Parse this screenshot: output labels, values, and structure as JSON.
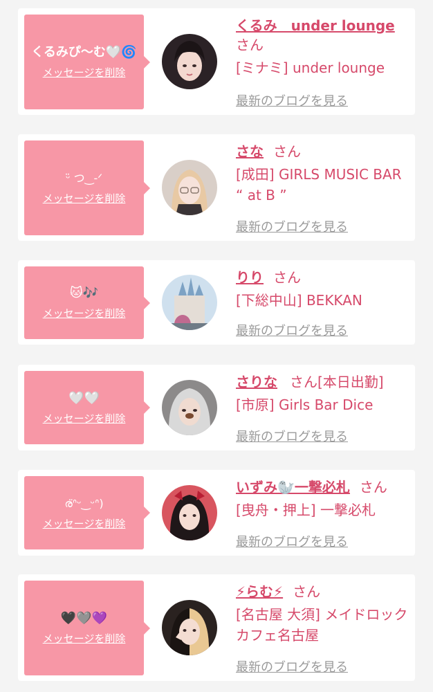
{
  "cards": [
    {
      "message": "くるみぴ〜む🤍🌀",
      "delete_label": "メッセージを削除",
      "name": "くるみ　under lounge",
      "honorific": "さん",
      "shop": "[ミナミ] under lounge",
      "blog_label": "最新のブログを見る"
    },
    {
      "message": "ᵕ̈ つ‿-ᐟ",
      "delete_label": "メッセージを削除",
      "name": "さな",
      "honorific": "さん",
      "shop": "[成田] GIRLS MUSIC BAR “ at B ”",
      "blog_label": "最新のブログを見る"
    },
    {
      "message": "🐱🎶",
      "delete_label": "メッセージを削除",
      "name": "りり",
      "honorific": "さん",
      "shop": "[下総中山] BEKKAN",
      "blog_label": "最新のブログを見る"
    },
    {
      "message": "🤍🤍",
      "delete_label": "メッセージを削除",
      "name": "さりな",
      "honorific": "さん[本日出勤]",
      "shop": "[市原] Girls Bar Dice",
      "blog_label": "最新のブログを見る"
    },
    {
      "message": "ര̈ᐢᵕ‿ᵕᐢ)",
      "delete_label": "メッセージを削除",
      "name": "いずみ🦭一撃必札",
      "honorific": "さん",
      "shop": "[曳舟・押上] 一撃必札",
      "blog_label": "最新のブログを見る"
    },
    {
      "message": "🖤🩶💜",
      "delete_label": "メッセージを削除",
      "name": "⚡らむ⚡",
      "honorific": "さん",
      "shop": "[名古屋 大須] メイドロックカフェ名古屋",
      "blog_label": "最新のブログを見る"
    }
  ]
}
